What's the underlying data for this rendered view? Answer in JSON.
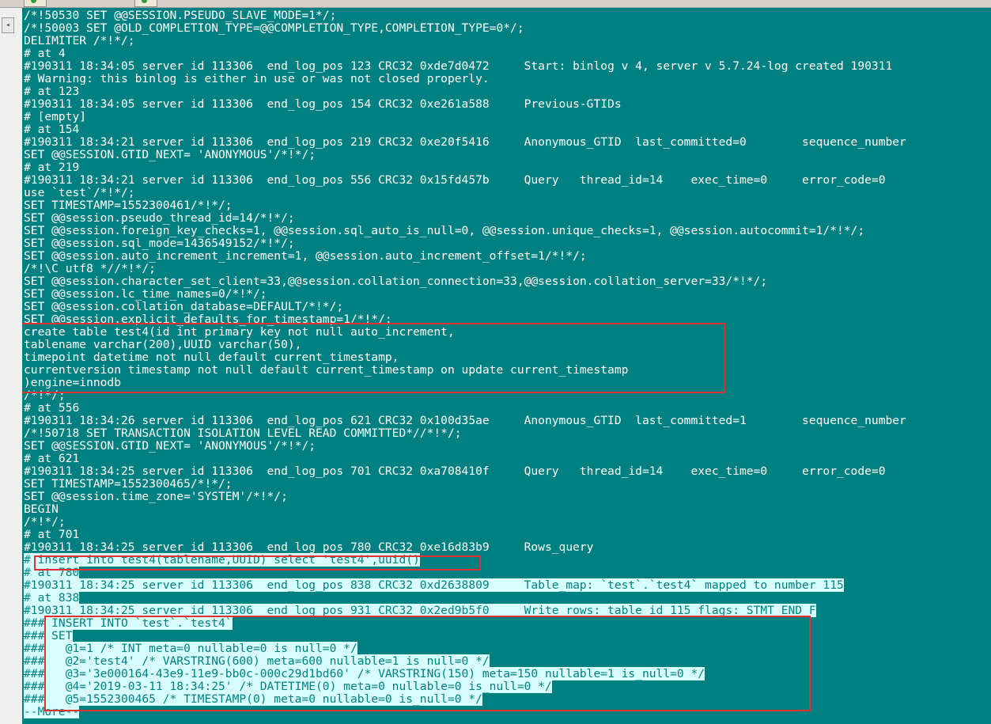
{
  "tabs": [
    "",
    ""
  ],
  "scroll_glyph": "◂",
  "lines": [
    {
      "text": "/*!50530 SET @@SESSION.PSEUDO_SLAVE_MODE=1*/;"
    },
    {
      "text": "/*!50003 SET @OLD_COMPLETION_TYPE=@@COMPLETION_TYPE,COMPLETION_TYPE=0*/;"
    },
    {
      "text": "DELIMITER /*!*/;"
    },
    {
      "text": "# at 4"
    },
    {
      "text": "#190311 18:34:05 server id 113306  end_log_pos 123 CRC32 0xde7d0472     Start: binlog v 4, server v 5.7.24-log created 190311"
    },
    {
      "text": "# Warning: this binlog is either in use or was not closed properly."
    },
    {
      "text": "# at 123"
    },
    {
      "text": "#190311 18:34:05 server id 113306  end_log_pos 154 CRC32 0xe261a588     Previous-GTIDs"
    },
    {
      "text": "# [empty]"
    },
    {
      "text": "# at 154"
    },
    {
      "text": "#190311 18:34:21 server id 113306  end_log_pos 219 CRC32 0xe20f5416     Anonymous_GTID  last_committed=0        sequence_number"
    },
    {
      "text": "SET @@SESSION.GTID_NEXT= 'ANONYMOUS'/*!*/;"
    },
    {
      "text": "# at 219"
    },
    {
      "text": "#190311 18:34:21 server id 113306  end_log_pos 556 CRC32 0x15fd457b     Query   thread_id=14    exec_time=0     error_code=0"
    },
    {
      "text": "use `test`/*!*/;"
    },
    {
      "text": "SET TIMESTAMP=1552300461/*!*/;"
    },
    {
      "text": "SET @@session.pseudo_thread_id=14/*!*/;"
    },
    {
      "text": "SET @@session.foreign_key_checks=1, @@session.sql_auto_is_null=0, @@session.unique_checks=1, @@session.autocommit=1/*!*/;"
    },
    {
      "text": "SET @@session.sql_mode=1436549152/*!*/;"
    },
    {
      "text": "SET @@session.auto_increment_increment=1, @@session.auto_increment_offset=1/*!*/;"
    },
    {
      "text": "/*!\\C utf8 *//*!*/;"
    },
    {
      "text": "SET @@session.character_set_client=33,@@session.collation_connection=33,@@session.collation_server=33/*!*/;"
    },
    {
      "text": "SET @@session.lc_time_names=0/*!*/;"
    },
    {
      "text": "SET @@session.collation_database=DEFAULT/*!*/;"
    },
    {
      "text": "SET @@session.explicit_defaults_for_timestamp=1/*!*/;"
    },
    {
      "text": "create table test4(id int primary key not null auto_increment,"
    },
    {
      "text": "tablename varchar(200),UUID varchar(50),"
    },
    {
      "text": "timepoint datetime not null default current_timestamp,"
    },
    {
      "text": "currentversion timestamp not null default current_timestamp on update current_timestamp"
    },
    {
      "text": ")engine=innodb"
    },
    {
      "text": "/*!*/;"
    },
    {
      "text": "# at 556"
    },
    {
      "text": "#190311 18:34:26 server id 113306  end_log_pos 621 CRC32 0x100d35ae     Anonymous_GTID  last_committed=1        sequence_number"
    },
    {
      "text": "/*!50718 SET TRANSACTION ISOLATION LEVEL READ COMMITTED*//*!*/;"
    },
    {
      "text": "SET @@SESSION.GTID_NEXT= 'ANONYMOUS'/*!*/;"
    },
    {
      "text": "# at 621"
    },
    {
      "text": "#190311 18:34:25 server id 113306  end_log_pos 701 CRC32 0xa708410f     Query   thread_id=14    exec_time=0     error_code=0"
    },
    {
      "text": "SET TIMESTAMP=1552300465/*!*/;"
    },
    {
      "text": "SET @@session.time_zone='SYSTEM'/*!*/;"
    },
    {
      "text": "BEGIN"
    },
    {
      "text": "/*!*/;"
    },
    {
      "text": "# at 701"
    },
    {
      "text": "#190311 18:34:25 server id 113306  end_log_pos 780 CRC32 0xe16d83b9     Rows_query"
    },
    {
      "text": "# insert into test4(tablename,UUID) select 'test4',uuid()",
      "hl": true
    },
    {
      "text": "# at 780",
      "hl": true
    },
    {
      "text": "#190311 18:34:25 server id 113306  end_log_pos 838 CRC32 0xd2638809     Table_map: `test`.`test4` mapped to number 115",
      "hl": true
    },
    {
      "text": "# at 838",
      "hl": true
    },
    {
      "text": "#190311 18:34:25 server id 113306  end_log_pos 931 CRC32 0x2ed9b5f0     Write_rows: table id 115 flags: STMT_END_F",
      "hl": true
    },
    {
      "text": "### INSERT INTO `test`.`test4`",
      "hl": true
    },
    {
      "text": "### SET",
      "hl": true
    },
    {
      "text": "###   @1=1 /* INT meta=0 nullable=0 is_null=0 */",
      "hl": true
    },
    {
      "text": "###   @2='test4' /* VARSTRING(600) meta=600 nullable=1 is_null=0 */",
      "hl": true
    },
    {
      "text": "###   @3='3e000164-43e9-11e9-bb0c-000c29d1bd60' /* VARSTRING(150) meta=150 nullable=1 is_null=0 */",
      "hl": true
    },
    {
      "text": "###   @4='2019-03-11 18:34:25' /* DATETIME(0) meta=0 nullable=0 is_null=0 */",
      "hl": true
    },
    {
      "text": "###   @5=1552300465 /* TIMESTAMP(0) meta=0 nullable=0 is_null=0 */",
      "hl": true
    }
  ],
  "more_prompt": "--More--",
  "colors": {
    "terminal_bg": "#008080",
    "text": "#ffffff",
    "selection_bg": "#d8ffff",
    "annotation": "#e03030"
  }
}
